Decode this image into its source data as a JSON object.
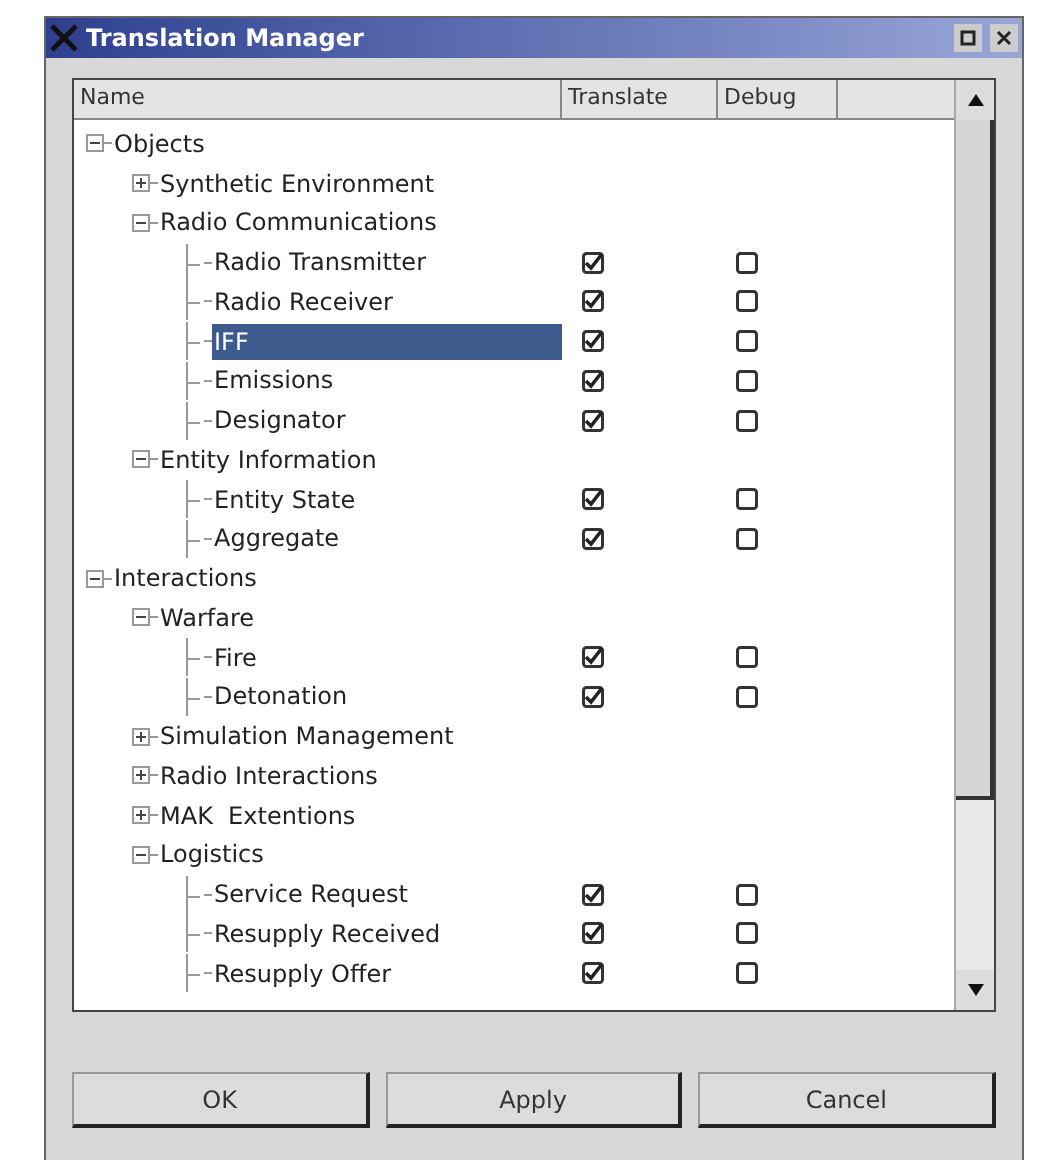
{
  "window": {
    "title": "Translation Manager"
  },
  "table": {
    "columns": [
      "Name",
      "Translate",
      "Debug"
    ],
    "tree": [
      {
        "label": "Objects",
        "expanded": true,
        "children": [
          {
            "label": "Synthetic Environment",
            "expanded": false
          },
          {
            "label": "Radio Communications",
            "expanded": true,
            "children": [
              {
                "label": "Radio Transmitter",
                "selected": false,
                "translate": true,
                "debug": false
              },
              {
                "label": "Radio Receiver",
                "selected": false,
                "translate": true,
                "debug": false
              },
              {
                "label": "IFF",
                "selected": true,
                "translate": true,
                "debug": false
              },
              {
                "label": "Emissions",
                "selected": false,
                "translate": true,
                "debug": false
              },
              {
                "label": "Designator",
                "selected": false,
                "translate": true,
                "debug": false
              }
            ]
          },
          {
            "label": "Entity Information",
            "expanded": true,
            "children": [
              {
                "label": "Entity State",
                "selected": false,
                "translate": true,
                "debug": false
              },
              {
                "label": "Aggregate",
                "selected": false,
                "translate": true,
                "debug": false
              }
            ]
          }
        ]
      },
      {
        "label": "Interactions",
        "expanded": true,
        "children": [
          {
            "label": "Warfare",
            "expanded": true,
            "children": [
              {
                "label": "Fire",
                "selected": false,
                "translate": true,
                "debug": false
              },
              {
                "label": "Detonation",
                "selected": false,
                "translate": true,
                "debug": false
              }
            ]
          },
          {
            "label": "Simulation Management",
            "expanded": false
          },
          {
            "label": "Radio Interactions",
            "expanded": false
          },
          {
            "label": "MAK  Extentions",
            "expanded": false
          },
          {
            "label": "Logistics",
            "expanded": true,
            "children": [
              {
                "label": "Service Request",
                "selected": false,
                "translate": true,
                "debug": false
              },
              {
                "label": "Resupply Received",
                "selected": false,
                "translate": true,
                "debug": false
              },
              {
                "label": "Resupply Offer",
                "selected": false,
                "translate": true,
                "debug": false
              }
            ]
          }
        ]
      }
    ]
  },
  "buttons": [
    "OK",
    "Apply",
    "Cancel"
  ]
}
